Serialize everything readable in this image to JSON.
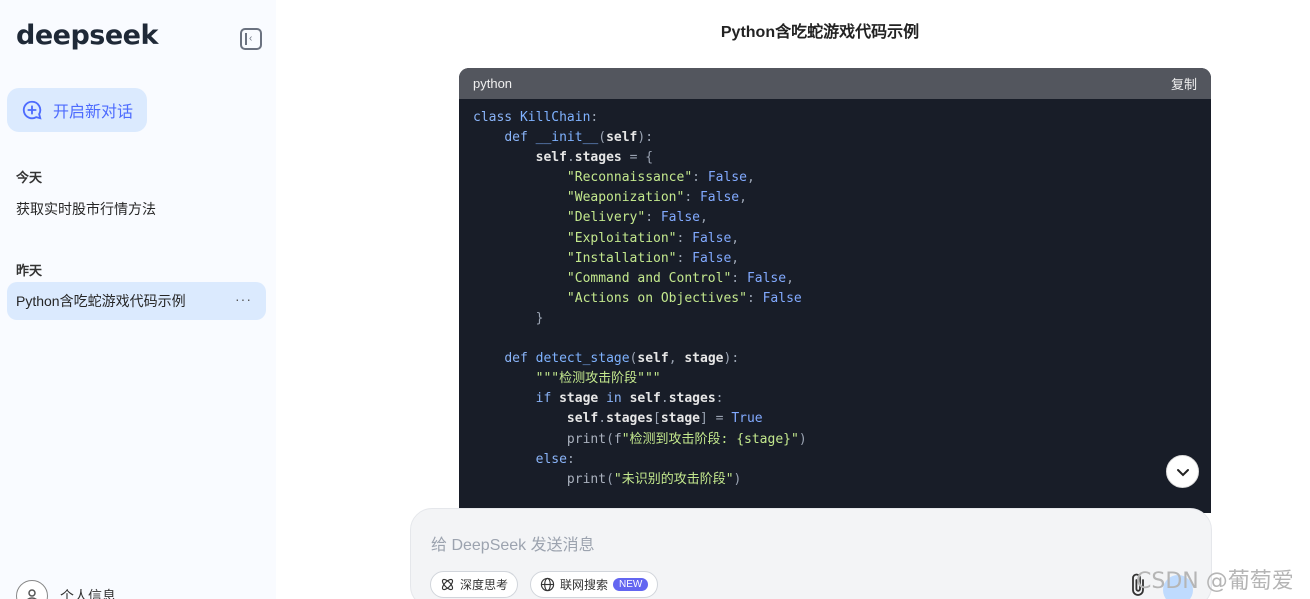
{
  "sidebar": {
    "logo": "deepseek",
    "new_chat_label": "开启新对话",
    "sections": [
      {
        "label": "今天",
        "items": [
          {
            "label": "获取实时股市行情方法"
          }
        ]
      },
      {
        "label": "昨天",
        "items": [
          {
            "label": "Python含吃蛇游戏代码示例",
            "more": "···"
          }
        ]
      }
    ],
    "profile_label": "个人信息"
  },
  "main": {
    "title": "Python含吃蛇游戏代码示例",
    "code_block": {
      "language": "python",
      "copy_label": "复制",
      "lines": [
        "class KillChain:",
        "    def __init__(self):",
        "        self.stages = {",
        "            \"Reconnaissance\": False,",
        "            \"Weaponization\": False,",
        "            \"Delivery\": False,",
        "            \"Exploitation\": False,",
        "            \"Installation\": False,",
        "            \"Command and Control\": False,",
        "            \"Actions on Objectives\": False",
        "        }",
        "",
        "    def detect_stage(self, stage):",
        "        \"\"\"检测攻击阶段\"\"\"",
        "        if stage in self.stages:",
        "            self.stages[stage] = True",
        "            print(f\"检测到攻击阶段: {stage}\")",
        "        else:",
        "            print(\"未识别的攻击阶段\")"
      ]
    },
    "input": {
      "placeholder": "给 DeepSeek 发送消息",
      "deep_think_label": "深度思考",
      "web_search_label": "联网搜索",
      "new_badge": "NEW"
    }
  },
  "watermark": "CSDN @葡萄爱",
  "colors": {
    "accent": "#4d6bfe",
    "sidebar_bg": "#f9fbff",
    "code_bg": "#181d28",
    "code_header": "#53565e"
  }
}
